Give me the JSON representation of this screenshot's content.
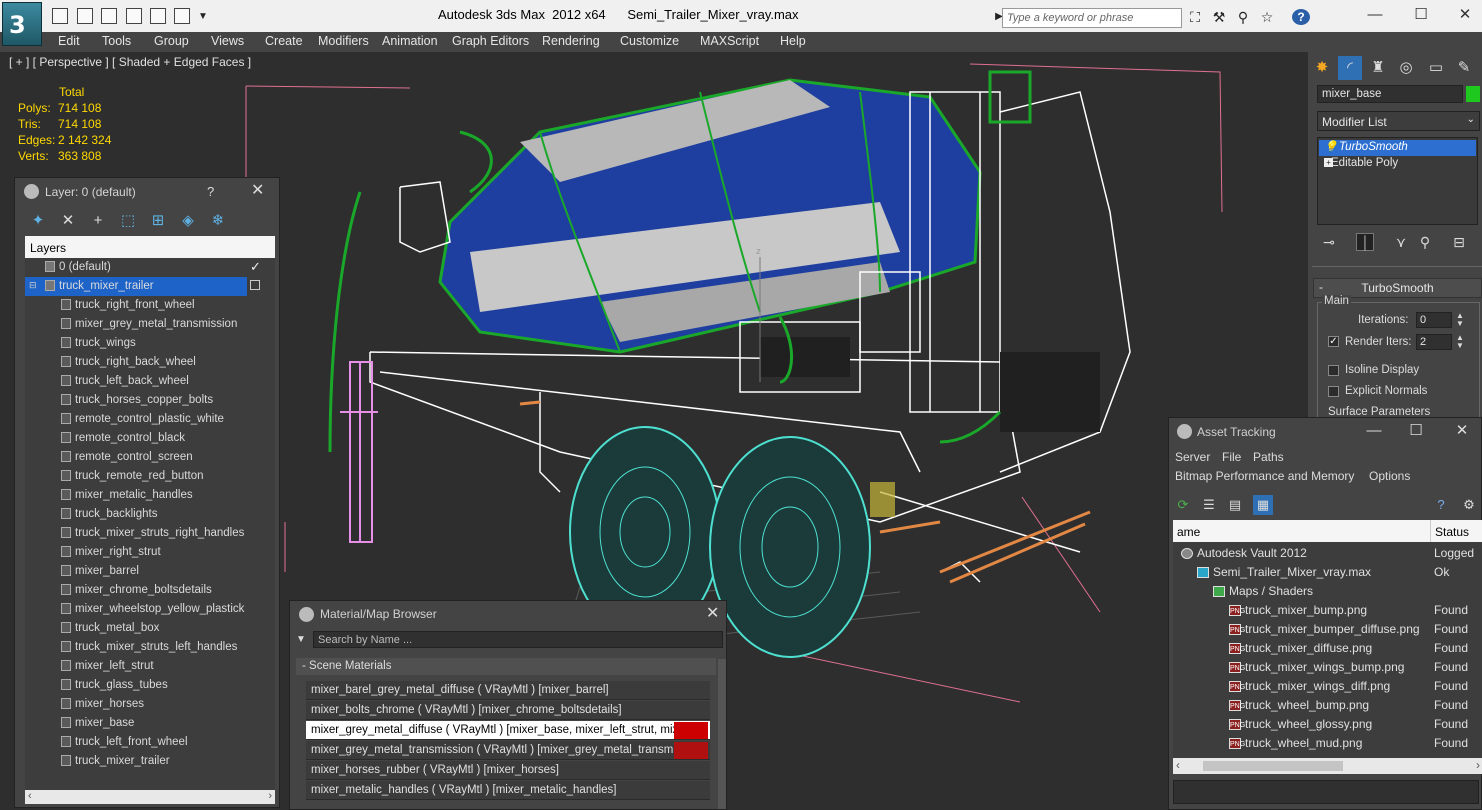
{
  "window": {
    "title": "Autodesk 3ds Max  2012 x64      Semi_Trailer_Mixer_vray.max",
    "search_placeholder": "Type a keyword or phrase",
    "logo": "3"
  },
  "menu": [
    "Edit",
    "Tools",
    "Group",
    "Views",
    "Create",
    "Modifiers",
    "Animation",
    "Graph Editors",
    "Rendering",
    "Customize",
    "MAXScript",
    "Help"
  ],
  "viewport": {
    "label": "[ + ] [ Perspective ] [ Shaded + Edged Faces ]",
    "axis_label": "z",
    "stats": {
      "header": "Total",
      "rows": [
        {
          "label": "Polys:",
          "value": "714 108"
        },
        {
          "label": "Tris:",
          "value": "714 108"
        },
        {
          "label": "Edges:",
          "value": "2 142 324"
        },
        {
          "label": "Verts:",
          "value": "363 808"
        }
      ]
    }
  },
  "layer_panel": {
    "title": "Layer: 0 (default)",
    "help": "?",
    "close": "✕",
    "column_header": "Layers",
    "default_layer": "0 (default)",
    "group_layer": "truck_mixer_trailer",
    "items": [
      "truck_right_front_wheel",
      "mixer_grey_metal_transmission",
      "truck_wings",
      "truck_right_back_wheel",
      "truck_left_back_wheel",
      "truck_horses_copper_bolts",
      "remote_control_plastic_white",
      "remote_control_black",
      "remote_control_screen",
      "truck_remote_red_button",
      "mixer_metalic_handles",
      "truck_backlights",
      "truck_mixer_struts_right_handles",
      "mixer_right_strut",
      "mixer_barrel",
      "mixer_chrome_boltsdetails",
      "mixer_wheelstop_yellow_plastick",
      "truck_metal_box",
      "truck_mixer_struts_left_handles",
      "mixer_left_strut",
      "truck_glass_tubes",
      "mixer_horses",
      "mixer_base",
      "truck_left_front_wheel",
      "truck_mixer_trailer"
    ]
  },
  "material_browser": {
    "title": "Material/Map Browser",
    "close": "✕",
    "search_placeholder": "Search by Name ...",
    "group": "- Scene Materials",
    "rows": [
      "mixer_barel_grey_metal_diffuse  ( VRayMtl ) [mixer_barrel]",
      "mixer_bolts_chrome  ( VRayMtl ) [mixer_chrome_boltsdetails]",
      "mixer_grey_metal_diffuse  ( VRayMtl ) [mixer_base, mixer_left_strut, mixer...",
      "mixer_grey_metal_transmission  ( VRayMtl ) [mixer_grey_metal_transmission]",
      "mixer_horses_rubber  ( VRayMtl ) [mixer_horses]",
      "mixer_metalic_handles  ( VRayMtl ) [mixer_metalic_handles]"
    ]
  },
  "command_panel": {
    "object_name": "mixer_base",
    "object_color": "#1ec81e",
    "modifier_list": "Modifier List",
    "stack": [
      "TurboSmooth",
      "Editable Poly"
    ],
    "rollout_title": "TurboSmooth",
    "group_main": "Main",
    "iterations_label": "Iterations:",
    "iterations_value": "0",
    "render_iters_label": "Render Iters:",
    "render_iters_value": "2",
    "isoline_label": "Isoline Display",
    "explicit_normals_label": "Explicit Normals",
    "surface_params": "Surface Parameters"
  },
  "asset_tracking": {
    "title": "Asset Tracking",
    "menu1": [
      "Server",
      "File",
      "Paths"
    ],
    "menu2": [
      "Bitmap Performance and Memory",
      "Options"
    ],
    "col_name": "ame",
    "col_status": "Status",
    "rows": [
      {
        "name": "Autodesk Vault 2012",
        "status": "Logged"
      },
      {
        "name": "Semi_Trailer_Mixer_vray.max",
        "status": "Ok"
      },
      {
        "name": "Maps / Shaders",
        "status": ""
      },
      {
        "name": "truck_mixer_bump.png",
        "status": "Found"
      },
      {
        "name": "truck_mixer_bumper_diffuse.png",
        "status": "Found"
      },
      {
        "name": "truck_mixer_diffuse.png",
        "status": "Found"
      },
      {
        "name": "truck_mixer_wings_bump.png",
        "status": "Found"
      },
      {
        "name": "truck_mixer_wings_diff.png",
        "status": "Found"
      },
      {
        "name": "truck_wheel_bump.png",
        "status": "Found"
      },
      {
        "name": "truck_wheel_glossy.png",
        "status": "Found"
      },
      {
        "name": "truck_wheel_mud.png",
        "status": "Found"
      }
    ],
    "png_tag": "PNG"
  }
}
